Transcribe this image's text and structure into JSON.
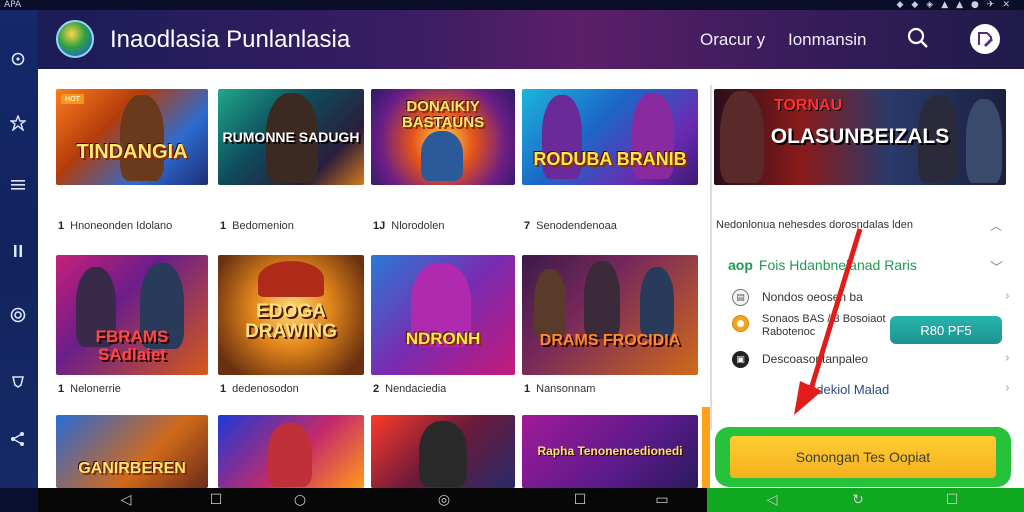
{
  "status_bar": {
    "left_text": "APA"
  },
  "header": {
    "title": "Inaodlasia Punlanlasia",
    "nav": [
      {
        "label": "Oracur  y"
      },
      {
        "label": "Ionmansin"
      }
    ],
    "search_icon": "search-icon",
    "profile_icon": "profile-edit-icon"
  },
  "left_rail": {
    "icons": [
      "location-icon",
      "puzzle-icon",
      "menu-icon",
      "pause-icon",
      "target-icon",
      "shield-icon",
      "share-icon"
    ]
  },
  "games": [
    {
      "badge": "HOT",
      "title": "TINDANGIA",
      "caption_num": "1",
      "caption": "Hnoneonden  Idolano"
    },
    {
      "badge": "",
      "title": "RUMONNE SADUGH",
      "caption_num": "1",
      "caption": "Bedomenion"
    },
    {
      "badge": "",
      "title": "DONAIKIY BASTAUNS",
      "caption_num": "1J",
      "caption": "Nlorodolen"
    },
    {
      "badge": "",
      "title": "RODUBA BRANIB",
      "caption_num": "7",
      "caption": "Senodendenoaa"
    },
    {
      "badge": "",
      "title": "OLASUNBEIZALS",
      "subtitle": "TORNAU",
      "caption_num": "",
      "caption": "Nedonlonua  nehesdes  dorosndalas  lden"
    },
    {
      "badge": "",
      "title": "FBRAMS SAdlaiet",
      "caption_num": "1",
      "caption": "Nelonerrie"
    },
    {
      "badge": "",
      "title": "EDOGA DRAWING",
      "caption_num": "1",
      "caption": "dedenosodon"
    },
    {
      "badge": "",
      "title": "NDRONH",
      "caption_num": "2",
      "caption": "Nendaciedia"
    },
    {
      "badge": "",
      "title": "DRAMS FROCIDIA",
      "caption_num": "1",
      "caption": "Nansonnam"
    },
    {
      "badge": "",
      "title": "GANIRBEREN",
      "caption_num": "",
      "caption": ""
    },
    {
      "badge": "",
      "title": "",
      "caption_num": "",
      "caption": ""
    },
    {
      "badge": "",
      "title": "",
      "caption_num": "",
      "caption": ""
    },
    {
      "badge": "",
      "title": "Rapha Tenonencedionedi",
      "caption_num": "",
      "caption": ""
    }
  ],
  "panel": {
    "options_head_prefix": "aop",
    "options_head": "Fois Hdanbnelanad Raris",
    "options": [
      {
        "icon": "document-icon",
        "label": "Nondos oeosen ba"
      },
      {
        "icon": "coin-icon",
        "label": "Sonaos  BAS / 3 Bosoiaot Rabotenoc"
      },
      {
        "icon": "device-icon",
        "label": "Descoasontanpaleo"
      },
      {
        "icon": "",
        "label": "Djdekiol Malad"
      }
    ],
    "price_label": "R80 PF5",
    "cta_label": "Sonongan Tes Oopiat"
  },
  "nav_bar": {
    "buttons": [
      "back-icon",
      "home-icon",
      "circle-icon",
      "circle-icon",
      "recents-icon",
      "screenshot-icon",
      "back-icon",
      "refresh-icon",
      "recents-icon"
    ]
  }
}
